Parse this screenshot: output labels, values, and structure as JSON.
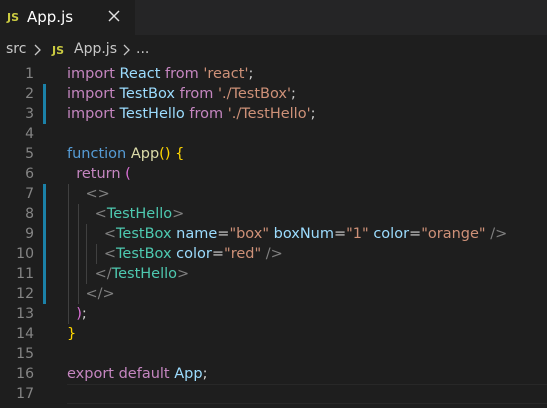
{
  "tab": {
    "badge": "JS",
    "label": "App.js",
    "close_icon": "close-icon"
  },
  "breadcrumb": {
    "folder": "src",
    "badge": "JS",
    "file": "App.js",
    "more": "..."
  },
  "editor": {
    "lines": [
      {
        "n": "1",
        "tokens": [
          [
            "kw",
            "import"
          ],
          [
            "op",
            " "
          ],
          [
            "vr",
            "React"
          ],
          [
            "op",
            " "
          ],
          [
            "kw",
            "from"
          ],
          [
            "op",
            " "
          ],
          [
            "st",
            "'react'"
          ],
          [
            "op",
            ";"
          ]
        ]
      },
      {
        "n": "2",
        "tokens": [
          [
            "kw",
            "import"
          ],
          [
            "op",
            " "
          ],
          [
            "vr",
            "TestBox"
          ],
          [
            "op",
            " "
          ],
          [
            "kw",
            "from"
          ],
          [
            "op",
            " "
          ],
          [
            "st",
            "'./TestBox'"
          ],
          [
            "op",
            ";"
          ]
        ]
      },
      {
        "n": "3",
        "tokens": [
          [
            "kw",
            "import"
          ],
          [
            "op",
            " "
          ],
          [
            "vr",
            "TestHello"
          ],
          [
            "op",
            " "
          ],
          [
            "kw",
            "from"
          ],
          [
            "op",
            " "
          ],
          [
            "st",
            "'./TestHello'"
          ],
          [
            "op",
            ";"
          ]
        ]
      },
      {
        "n": "4",
        "tokens": []
      },
      {
        "n": "5",
        "tokens": [
          [
            "bl",
            "function"
          ],
          [
            "op",
            " "
          ],
          [
            "fn",
            "App"
          ],
          [
            "br1",
            "()"
          ],
          [
            "op",
            " "
          ],
          [
            "br1",
            "{"
          ]
        ]
      },
      {
        "n": "6",
        "tokens": [
          [
            "op",
            "  "
          ],
          [
            "kw",
            "return"
          ],
          [
            "op",
            " "
          ],
          [
            "br2",
            "("
          ]
        ]
      },
      {
        "n": "7",
        "tokens": [
          [
            "op",
            "    "
          ],
          [
            "pn",
            "<>"
          ]
        ]
      },
      {
        "n": "8",
        "tokens": [
          [
            "op",
            "      "
          ],
          [
            "pn",
            "<"
          ],
          [
            "tg",
            "TestHello"
          ],
          [
            "pn",
            ">"
          ]
        ]
      },
      {
        "n": "9",
        "tokens": [
          [
            "op",
            "        "
          ],
          [
            "pn",
            "<"
          ],
          [
            "tg",
            "TestBox"
          ],
          [
            "op",
            " "
          ],
          [
            "vr",
            "name"
          ],
          [
            "op",
            "="
          ],
          [
            "st",
            "\"box\""
          ],
          [
            "op",
            " "
          ],
          [
            "vr",
            "boxNum"
          ],
          [
            "op",
            "="
          ],
          [
            "st",
            "\"1\""
          ],
          [
            "op",
            " "
          ],
          [
            "vr",
            "color"
          ],
          [
            "op",
            "="
          ],
          [
            "st",
            "\"orange\""
          ],
          [
            "op",
            " "
          ],
          [
            "pn",
            "/>"
          ]
        ]
      },
      {
        "n": "10",
        "tokens": [
          [
            "op",
            "        "
          ],
          [
            "pn",
            "<"
          ],
          [
            "tg",
            "TestBox"
          ],
          [
            "op",
            " "
          ],
          [
            "vr",
            "color"
          ],
          [
            "op",
            "="
          ],
          [
            "st",
            "\"red\""
          ],
          [
            "op",
            " "
          ],
          [
            "pn",
            "/>"
          ]
        ]
      },
      {
        "n": "11",
        "tokens": [
          [
            "op",
            "      "
          ],
          [
            "pn",
            "</"
          ],
          [
            "tg",
            "TestHello"
          ],
          [
            "pn",
            ">"
          ]
        ]
      },
      {
        "n": "12",
        "tokens": [
          [
            "op",
            "    "
          ],
          [
            "pn",
            "</>"
          ]
        ]
      },
      {
        "n": "13",
        "tokens": [
          [
            "op",
            "  "
          ],
          [
            "br2",
            ")"
          ],
          [
            "op",
            ";"
          ]
        ]
      },
      {
        "n": "14",
        "tokens": [
          [
            "br1",
            "}"
          ]
        ]
      },
      {
        "n": "15",
        "tokens": []
      },
      {
        "n": "16",
        "tokens": [
          [
            "kw",
            "export"
          ],
          [
            "op",
            " "
          ],
          [
            "kw",
            "default"
          ],
          [
            "op",
            " "
          ],
          [
            "vr",
            "App"
          ],
          [
            "op",
            ";"
          ]
        ]
      },
      {
        "n": "17",
        "tokens": []
      }
    ],
    "modified_lines": [
      "2",
      "3",
      "7",
      "8",
      "9",
      "10",
      "11",
      "12"
    ],
    "cursor_line": "17"
  },
  "colors": {
    "background": "#1e1e1e",
    "tabbar": "#252526",
    "gutter_modified": "#1b81a8",
    "js_badge": "#cbcb41"
  }
}
